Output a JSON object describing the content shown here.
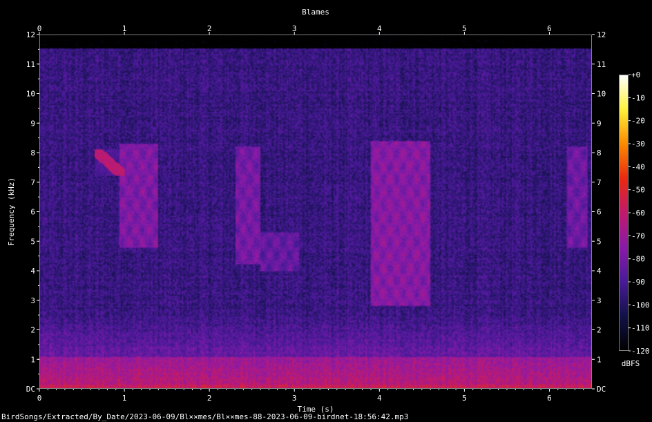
{
  "chart_data": {
    "type": "heatmap",
    "title": "Blames",
    "xlabel": "Time (s)",
    "ylabel": "Frequency (kHz)",
    "xlim": [
      0,
      6.5
    ],
    "ylim": [
      0,
      12
    ],
    "x_ticks": [
      "0",
      "1",
      "2",
      "3",
      "4",
      "5",
      "6"
    ],
    "y_ticks": [
      "DC",
      "1",
      "2",
      "3",
      "4",
      "5",
      "6",
      "7",
      "8",
      "9",
      "10",
      "11",
      "12"
    ],
    "colorbar": {
      "label": "dBFS",
      "ticks": [
        "+0",
        "-10",
        "-20",
        "-30",
        "-40",
        "-50",
        "-60",
        "-70",
        "-80",
        "-90",
        "-100",
        "-110",
        "-120"
      ],
      "range": [
        -120,
        0
      ],
      "colors": [
        "#000000",
        "#12124a",
        "#4a1a9a",
        "#8a1aa8",
        "#c21a6c",
        "#ea2a10",
        "#fb8a00",
        "#fff23a",
        "#ffffff"
      ]
    },
    "background_level": -95,
    "events": [
      {
        "t0": 0.65,
        "t1": 1.0,
        "f0": 7.2,
        "f1": 8.1,
        "level": -62,
        "description": "descending sweep"
      },
      {
        "t0": 0.95,
        "t1": 1.4,
        "f0": 4.8,
        "f1": 8.3,
        "level": -78
      },
      {
        "t0": 2.3,
        "t1": 2.6,
        "f0": 4.2,
        "f1": 8.2,
        "level": -80
      },
      {
        "t0": 2.6,
        "t1": 3.05,
        "f0": 4.0,
        "f1": 5.3,
        "level": -84
      },
      {
        "t0": 3.9,
        "t1": 4.6,
        "f0": 2.8,
        "f1": 8.4,
        "level": -76
      },
      {
        "t0": 6.2,
        "t1": 6.45,
        "f0": 4.8,
        "f1": 8.2,
        "level": -82
      }
    ]
  },
  "footer": {
    "file_path": "BirdSongs/Extracted/By_Date/2023-06-09/Bl××mes/Bl××mes-88-2023-06-09-birdnet-18:56:42.mp3"
  }
}
